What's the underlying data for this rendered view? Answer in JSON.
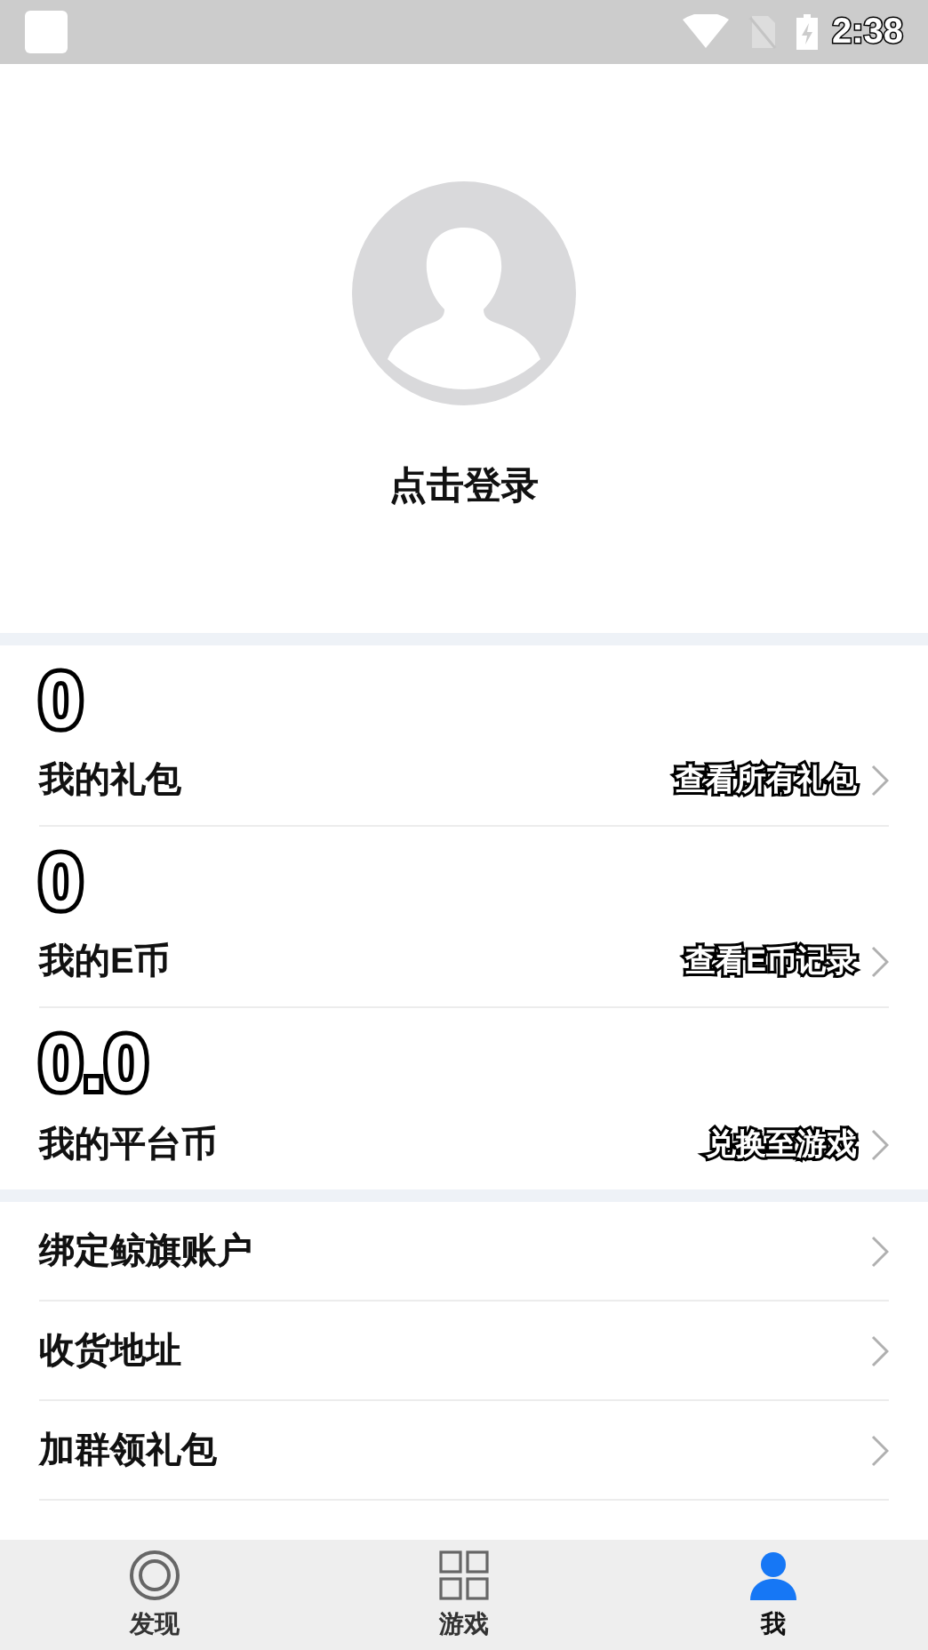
{
  "status_bar": {
    "time": "2:38"
  },
  "profile": {
    "login_label": "点击登录"
  },
  "stats": [
    {
      "value": "0",
      "label": "我的礼包",
      "link": "查看所有礼包"
    },
    {
      "value": "0",
      "label": "我的E币",
      "link": "查看E币记录"
    },
    {
      "value": "0.0",
      "label": "我的平台币",
      "link": "兑换至游戏"
    }
  ],
  "menu": [
    {
      "label": "绑定鲸旗账户"
    },
    {
      "label": "收货地址"
    },
    {
      "label": "加群领礼包"
    }
  ],
  "bottom_nav": [
    {
      "label": "发现",
      "kind": "discover",
      "selected": false
    },
    {
      "label": "游戏",
      "kind": "games",
      "selected": false
    },
    {
      "label": "我",
      "kind": "me",
      "selected": true
    }
  ]
}
